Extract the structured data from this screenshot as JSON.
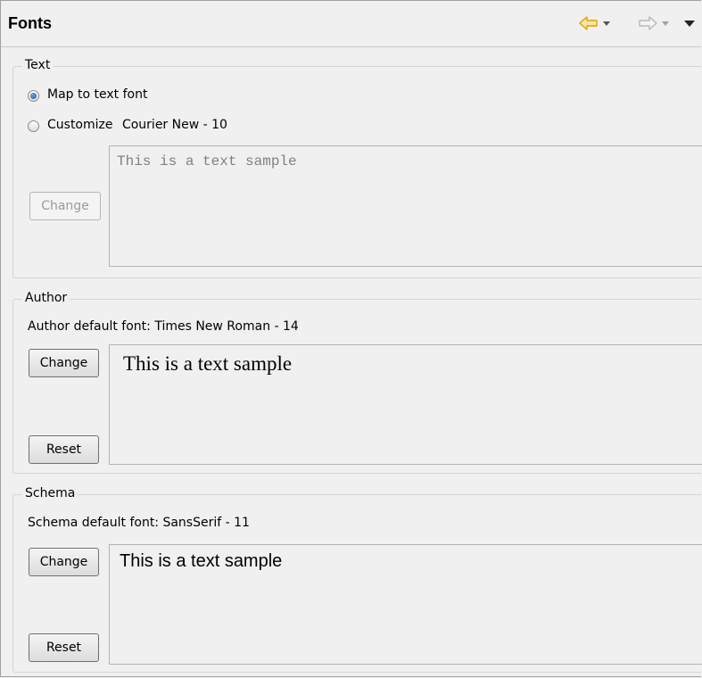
{
  "header": {
    "title": "Fonts",
    "accent_color": "#e8a317",
    "icons": [
      "back-arrow-icon",
      "forward-arrow-icon",
      "view-menu-icon"
    ]
  },
  "text_group": {
    "legend": "Text",
    "radio_map_label": "Map to text font",
    "radio_map_checked": true,
    "radio_customize_label": "Customize",
    "customize_font": "Courier New - 10",
    "change_label": "Change",
    "sample_text": "This is a text sample"
  },
  "author_group": {
    "legend": "Author",
    "default_font_label": "Author default font: Times New Roman - 14",
    "change_label": "Change",
    "reset_label": "Reset",
    "sample_text": "This is a text sample"
  },
  "schema_group": {
    "legend": "Schema",
    "default_font_label": "Schema default font: SansSerif - 11",
    "change_label": "Change",
    "reset_label": "Reset",
    "sample_text": "This is a text sample"
  }
}
